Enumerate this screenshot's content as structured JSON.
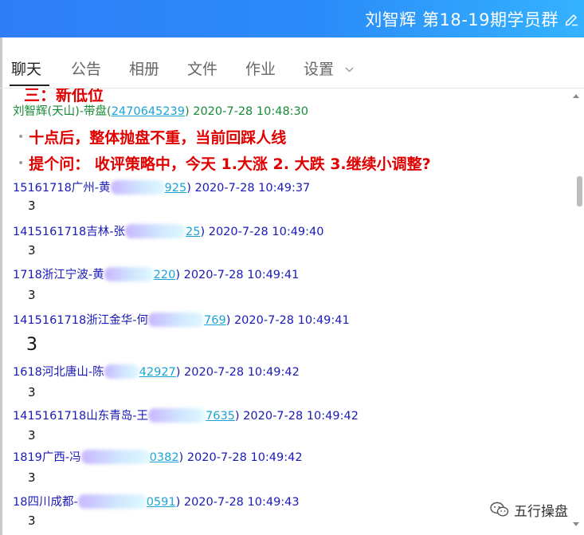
{
  "header": {
    "title": "刘智辉 第18-19期学员群"
  },
  "tabs": [
    {
      "label": "聊天"
    },
    {
      "label": "公告"
    },
    {
      "label": "相册"
    },
    {
      "label": "文件"
    },
    {
      "label": "作业"
    },
    {
      "label": "设置"
    }
  ],
  "chat": {
    "cut_text": "三：新低位",
    "host": {
      "name": "刘智辉(天山)-带盘(",
      "qq": "2470645239",
      "time": ") 2020-7-28 10:48:30",
      "lines": [
        "十点后，整体抛盘不重，当前回踩人线",
        "提个问： 收评策略中，今天 1.大涨 2. 大跌 3.继续小调整?"
      ]
    },
    "messages": [
      {
        "name": "15161718广州-黄",
        "qq_tail": "925",
        "time": ") 2020-7-28 10:49:37",
        "text": "3"
      },
      {
        "name": "1415161718吉林-张",
        "qq_tail": "25",
        "time": ") 2020-7-28 10:49:40",
        "text": "3"
      },
      {
        "name": "1718浙江宁波-黄",
        "qq_tail": "220",
        "time": ") 2020-7-28 10:49:41",
        "text": "3"
      },
      {
        "name": "1415161718浙江金华-何",
        "qq_tail": "769",
        "time": ") 2020-7-28 10:49:41",
        "text": "3"
      },
      {
        "name": "1618河北唐山-陈",
        "qq_tail": "42927",
        "time": ") 2020-7-28 10:49:42",
        "text": "3"
      },
      {
        "name": "1415161718山东青岛-王",
        "qq_tail": "7635",
        "time": ") 2020-7-28 10:49:42",
        "text": "3"
      },
      {
        "name": "1819广西-冯",
        "qq_tail": "0382",
        "time": ") 2020-7-28 10:49:42",
        "text": "3"
      },
      {
        "name": "18四川成都-",
        "qq_tail": "0591",
        "time": ") 2020-7-28 10:49:43",
        "text": "3"
      }
    ]
  },
  "watermark": {
    "text": "五行操盘"
  },
  "colors": {
    "accent": "#2f7df6",
    "red": "#e00000",
    "green": "#168c35",
    "blue": "#1a1ab8",
    "link": "#1aa3d6"
  }
}
